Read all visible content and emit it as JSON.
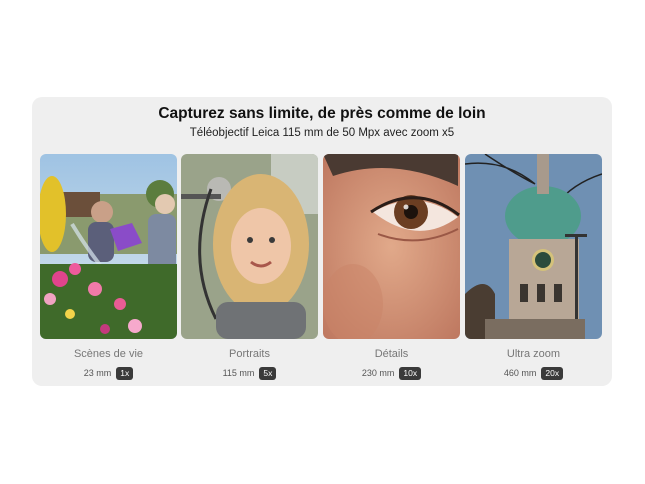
{
  "header": {
    "title": "Capturez sans limite, de près comme de loin",
    "subtitle": "Téléobjectif Leica 115 mm de 50 Mpx avec zoom x5"
  },
  "tiles": [
    {
      "label": "Scènes de vie",
      "focal": "23 mm",
      "zoom": "1x",
      "image": "scene-photo"
    },
    {
      "label": "Portraits",
      "focal": "115 mm",
      "zoom": "5x",
      "image": "portrait-photo"
    },
    {
      "label": "Détails",
      "focal": "230 mm",
      "zoom": "10x",
      "image": "eye-detail-photo"
    },
    {
      "label": "Ultra zoom",
      "focal": "460 mm",
      "zoom": "20x",
      "image": "clock-tower-photo"
    }
  ]
}
